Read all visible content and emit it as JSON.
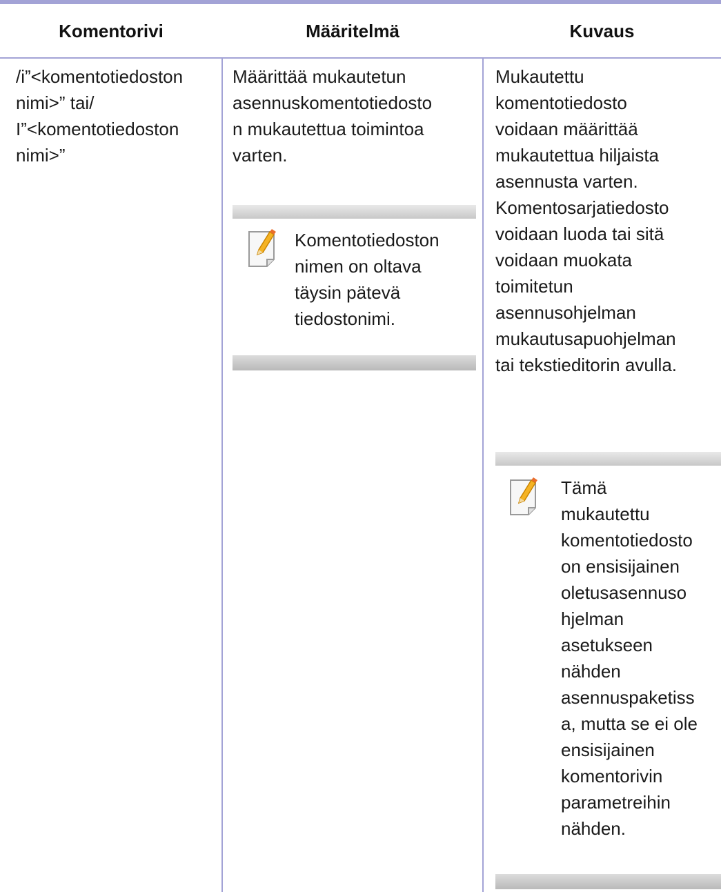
{
  "table": {
    "headers": [
      "Komentorivi",
      "Määritelmä",
      "Kuvaus"
    ],
    "row": {
      "command_lines": [
        "/i”<komentotiedoston",
        "nimi>” tai/",
        "I”<komentotiedoston",
        "nimi>”"
      ],
      "definition_lines": [
        "Määrittää mukautetun",
        "asennuskomentotiedosto",
        "n mukautettua toimintoa",
        "varten."
      ],
      "definition_note_lines": [
        "Komentotiedoston",
        "nimen on oltava",
        "täysin pätevä",
        "tiedostonimi."
      ],
      "description_lines": [
        "Mukautettu",
        "komentotiedosto",
        "voidaan määrittää",
        "mukautettua hiljaista",
        "asennusta varten.",
        "Komentosarjatiedosto",
        "voidaan luoda tai sitä",
        "voidaan muokata",
        "toimitetun",
        "asennusohjelman",
        "mukautusapuohjelman",
        "tai tekstieditorin avulla."
      ],
      "description_note_lines": [
        "Tämä",
        "mukautettu",
        "komentotiedosto",
        "on ensisijainen",
        "oletusasennuso",
        "hjelman",
        "asetukseen",
        "nähden",
        "asennuspaketiss",
        "a, mutta se ei ole",
        "ensisijainen",
        "komentorivin",
        "parametreihin",
        "nähden."
      ]
    }
  },
  "icons": {
    "note": "note-pencil-icon"
  },
  "colors": {
    "rule": "#a3a3d6",
    "note_bar": "#c8c8c8",
    "pencil": "#f0a818"
  }
}
